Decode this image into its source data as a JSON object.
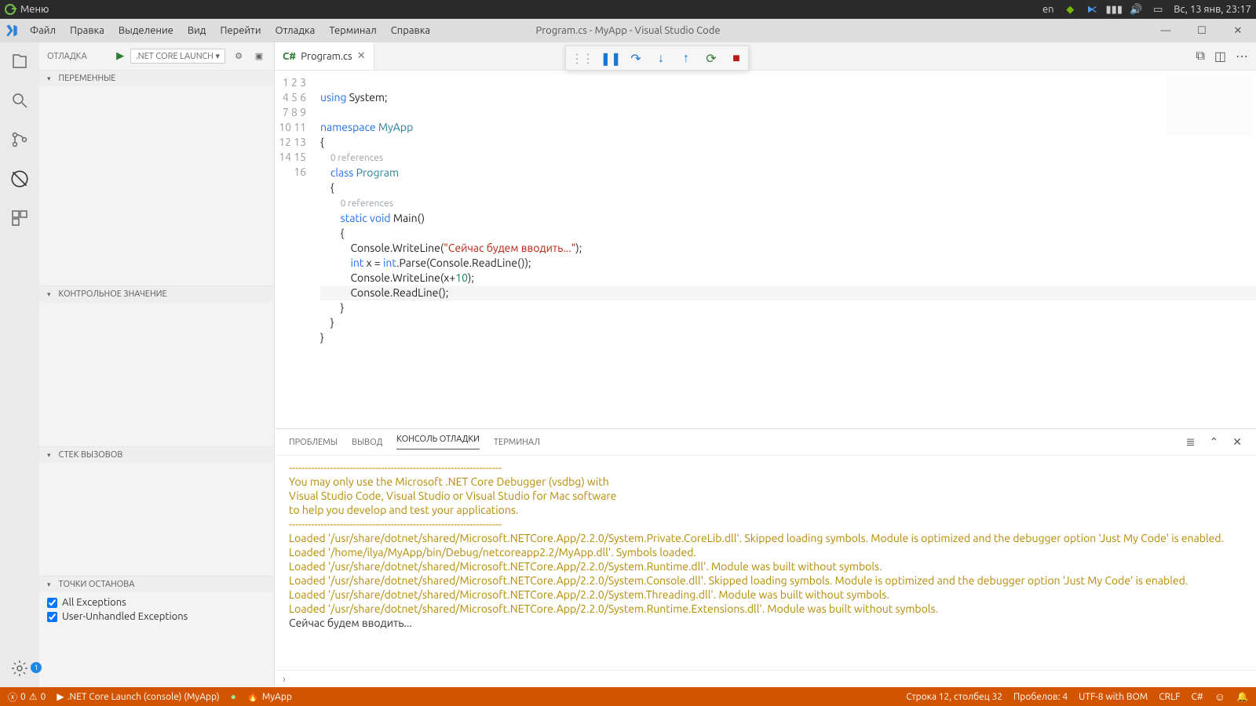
{
  "desktop": {
    "menu": "Меню",
    "lang": "en",
    "datetime": "Вс, 13 янв, 23:17"
  },
  "titlebar": {
    "menus": [
      "Файл",
      "Правка",
      "Выделение",
      "Вид",
      "Перейти",
      "Отладка",
      "Терминал",
      "Справка"
    ],
    "title": "Program.cs - MyApp - Visual Studio Code"
  },
  "sidebar": {
    "title": "ОТЛАДКА",
    "launch": ".NET Core Launch ▾",
    "sections": {
      "vars": "ПЕРЕМЕННЫЕ",
      "watch": "КОНТРОЛЬНОЕ ЗНАЧЕНИЕ",
      "call": "СТЕК ВЫЗОВОВ",
      "bp": "ТОЧКИ ОСТАНОВА"
    },
    "breakpoints": [
      "All Exceptions",
      "User-Unhandled Exceptions"
    ]
  },
  "tab": {
    "name": "Program.cs"
  },
  "code": {
    "l1a": "using ",
    "l1b": "System;",
    "l3a": "namespace ",
    "l3b": "MyApp",
    "l4": "{",
    "ref0": "0 references",
    "l5a": "    class ",
    "l5b": "Program",
    "l6": "    {",
    "ref1": "0 references",
    "l7a": "        static ",
    "l7b": "void ",
    "l7c": "Main()",
    "l8": "        {",
    "l9a": "            Console.WriteLine(",
    "l9b": "\"Сейчас будем вводить...\"",
    "l9c": ");",
    "l10a": "            ",
    "l10b": "int ",
    "l10c": "x = ",
    "l10d": "int",
    "l10e": ".Parse(Console.ReadLine());",
    "l11a": "            Console.WriteLine(x+",
    "l11b": "10",
    "l11c": ");",
    "l12": "            Console.ReadLine();",
    "l13": "        }",
    "l14": "    }",
    "l15": "}"
  },
  "panel": {
    "tabs": [
      "ПРОБЛЕМЫ",
      "ВЫВОД",
      "КОНСОЛЬ ОТЛАДКИ",
      "ТЕРМИНАЛ"
    ],
    "lines": [
      "-------------------------------------------------------------------",
      "You may only use the Microsoft .NET Core Debugger (vsdbg) with",
      "Visual Studio Code, Visual Studio or Visual Studio for Mac software",
      "to help you develop and test your applications.",
      "-------------------------------------------------------------------",
      "Loaded '/usr/share/dotnet/shared/Microsoft.NETCore.App/2.2.0/System.Private.CoreLib.dll'. Skipped loading symbols. Module is optimized and the debugger option 'Just My Code' is enabled.",
      "Loaded '/home/ilya/MyApp/bin/Debug/netcoreapp2.2/MyApp.dll'. Symbols loaded.",
      "Loaded '/usr/share/dotnet/shared/Microsoft.NETCore.App/2.2.0/System.Runtime.dll'. Module was built without symbols.",
      "Loaded '/usr/share/dotnet/shared/Microsoft.NETCore.App/2.2.0/System.Console.dll'. Skipped loading symbols. Module is optimized and the debugger option 'Just My Code' is enabled.",
      "Loaded '/usr/share/dotnet/shared/Microsoft.NETCore.App/2.2.0/System.Threading.dll'. Module was built without symbols.",
      "Loaded '/usr/share/dotnet/shared/Microsoft.NETCore.App/2.2.0/System.Runtime.Extensions.dll'. Module was built without symbols."
    ],
    "runLine": "Сейчас будем вводить..."
  },
  "status": {
    "errors": "0",
    "warnings": "0",
    "launch": ".NET Core Launch (console) (MyApp)",
    "project": "MyApp",
    "pos": "Строка 12, столбец 32",
    "spaces": "Пробелов: 4",
    "enc": "UTF-8 with BOM",
    "eol": "CRLF",
    "lang": "C#",
    "settings_badge": "1"
  }
}
